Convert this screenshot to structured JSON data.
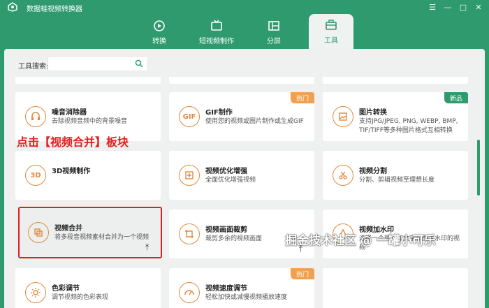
{
  "app": {
    "title": "数据蛙视频转换器"
  },
  "window_buttons": [
    "☰",
    "—",
    "□",
    "✕"
  ],
  "tabs": [
    {
      "label": "转换",
      "icon": "convert-icon"
    },
    {
      "label": "短视频制作",
      "icon": "tv-icon"
    },
    {
      "label": "分屏",
      "icon": "split-screen-icon"
    },
    {
      "label": "工具",
      "icon": "toolbox-icon",
      "active": true
    }
  ],
  "search": {
    "label": "工具搜索:",
    "placeholder": ""
  },
  "cards": [
    {
      "title": "噪音消除器",
      "desc": "去除视频音频中的背景噪音",
      "icon": "noise-remove-icon"
    },
    {
      "title": "GIF制作",
      "desc": "使用您的视频或图片制作或生成GIF",
      "icon": "gif-icon",
      "icon_text": "GIF",
      "badge": "热门"
    },
    {
      "title": "图片转换",
      "desc": "支持JPG/JPEG, PNG, WEBP, BMP, TIF/TIFF等多种图片格式互相转换",
      "icon": "image-convert-icon",
      "badge": "新品"
    },
    {
      "title": "3D视频制作",
      "desc": "",
      "icon": "3d-icon",
      "icon_text": "3D"
    },
    {
      "title": "视频优化增强",
      "desc": "全面优化增强视频",
      "icon": "enhance-icon"
    },
    {
      "title": "视频分割",
      "desc": "分割、剪辑视频至理想长度",
      "icon": "scissors-icon"
    },
    {
      "title": "视频合并",
      "desc": "将多段音视频素材合并为一个视频",
      "icon": "merge-icon"
    },
    {
      "title": "视频画面裁剪",
      "desc": "裁剪多余的视频画面",
      "icon": "crop-icon"
    },
    {
      "title": "视频加水印",
      "desc": "选择一个想添加文字和图片水印的视频",
      "icon": "watermark-icon"
    },
    {
      "title": "色彩调节",
      "desc": "调节视频的色彩表现",
      "icon": "color-icon"
    },
    {
      "title": "视频速度调节",
      "desc": "轻松加快或减慢视频播放速度",
      "icon": "speed-icon",
      "badge": "热门"
    },
    {
      "title": "",
      "desc": "",
      "icon": ""
    }
  ],
  "annotation": "点击【视频合并】板块",
  "watermark": "掘金技术社区 @ 一罐小可乐",
  "colors": {
    "brand": "#2e9a6e",
    "accent": "#e08a3c",
    "hot": "#f0a050",
    "highlight": "#e02020"
  }
}
